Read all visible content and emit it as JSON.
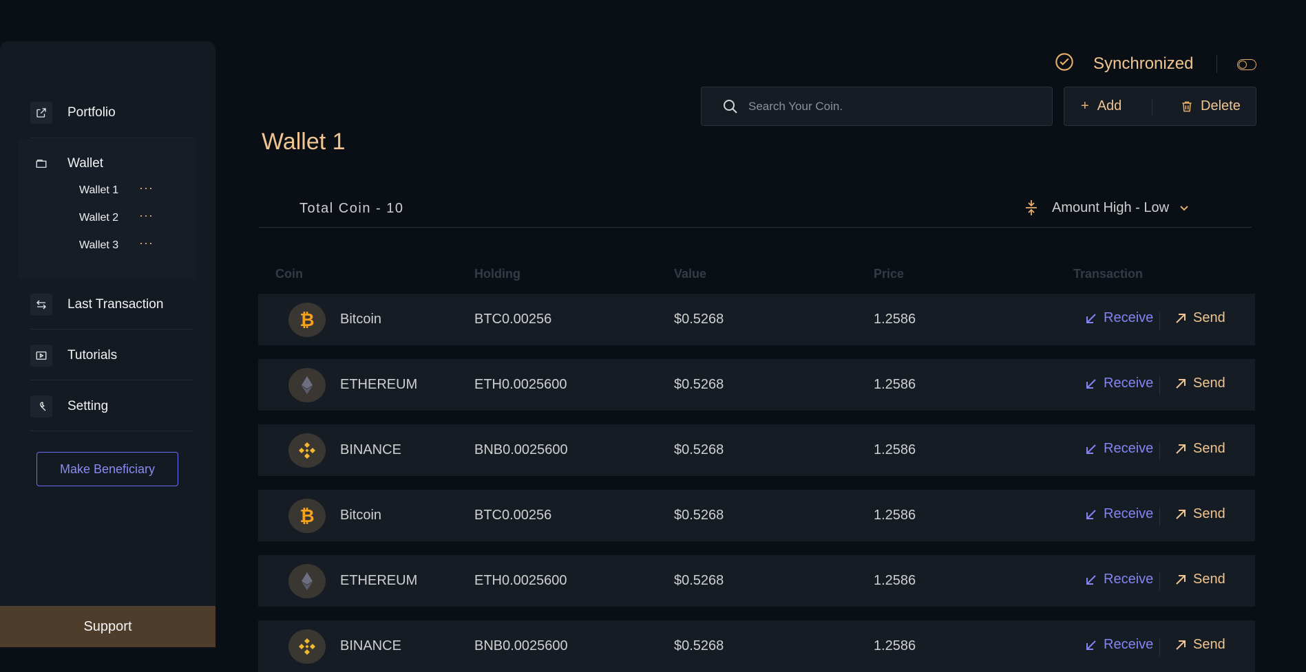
{
  "sidebar": {
    "portfolio": "Portfolio",
    "wallet": "Wallet",
    "wallets": [
      "Wallet 1",
      "Wallet 2",
      "Wallet 3"
    ],
    "wallet_menu": "···",
    "last_transaction": "Last Transaction",
    "tutorials": "Tutorials",
    "setting": "Setting",
    "beneficiary": "Make Beneficiary",
    "support": "Support"
  },
  "header": {
    "sync_label": "Synchronized",
    "search_placeholder": "Search Your Coin.",
    "add_label": "Add",
    "delete_label": "Delete"
  },
  "main": {
    "title": "Wallet 1",
    "total_coin": "Total Coin - 10",
    "sort_label": "Amount High - Low"
  },
  "table": {
    "columns": [
      "Coin",
      "Holding",
      "Value",
      "Price",
      "Transaction"
    ],
    "receive_label": "Receive",
    "send_label": "Send",
    "rows": [
      {
        "coin": "Bitcoin",
        "icon": "bitcoin-icon",
        "holding": "BTC0.00256",
        "value": "$0.5268",
        "price": "1.2586"
      },
      {
        "coin": "ETHEREUM",
        "icon": "ethereum-icon",
        "holding": "ETH0.0025600",
        "value": "$0.5268",
        "price": "1.2586"
      },
      {
        "coin": "BINANCE",
        "icon": "binance-icon",
        "holding": "BNB0.0025600",
        "value": "$0.5268",
        "price": "1.2586"
      },
      {
        "coin": "Bitcoin",
        "icon": "bitcoin-icon",
        "holding": "BTC0.00256",
        "value": "$0.5268",
        "price": "1.2586"
      },
      {
        "coin": "ETHEREUM",
        "icon": "ethereum-icon",
        "holding": "ETH0.0025600",
        "value": "$0.5268",
        "price": "1.2586"
      },
      {
        "coin": "BINANCE",
        "icon": "binance-icon",
        "holding": "BNB0.0025600",
        "value": "$0.5268",
        "price": "1.2586"
      }
    ]
  },
  "colors": {
    "accent": "#f0c591",
    "receive": "#8484f5",
    "background": "#0a0f16",
    "panel": "#161c24"
  }
}
